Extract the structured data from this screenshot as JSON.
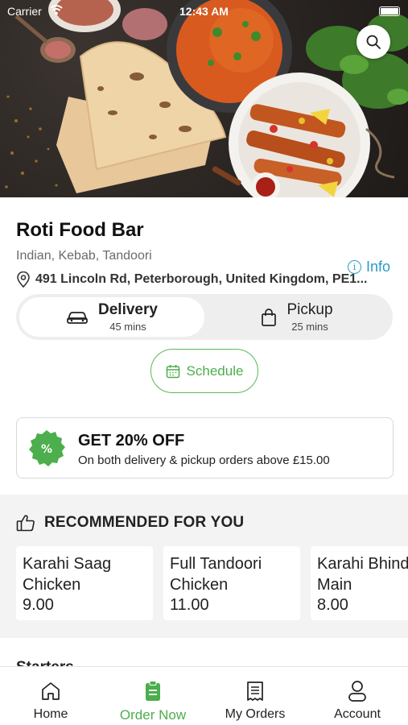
{
  "status_bar": {
    "carrier": "Carrier",
    "time": "12:43 AM"
  },
  "hero": {
    "image": "food-banner-image"
  },
  "restaurant": {
    "name": "Roti Food Bar",
    "cuisine": "Indian, Kebab, Tandoori",
    "info_label": "Info",
    "address": "491 Lincoln Rd, Peterborough, United Kingdom, PE1..."
  },
  "order_mode": {
    "delivery": {
      "label": "Delivery",
      "time": "45 mins",
      "selected": true
    },
    "pickup": {
      "label": "Pickup",
      "time": "25 mins",
      "selected": false
    }
  },
  "schedule": {
    "label": "Schedule"
  },
  "offer": {
    "badge_symbol": "%",
    "title": "GET 20% OFF",
    "description": "On both delivery & pickup orders above £15.00"
  },
  "recommended": {
    "heading": "RECOMMENDED FOR YOU",
    "items": [
      {
        "name": "Karahi Saag\nChicken",
        "price": "9.00"
      },
      {
        "name": "Full Tandoori\nChicken",
        "price": "11.00"
      },
      {
        "name": "Karahi Bhindi\nMain",
        "price": "8.00"
      }
    ]
  },
  "next_section": {
    "title": "Starters"
  },
  "bottom_nav": {
    "items": [
      {
        "label": "Home",
        "icon": "home-icon"
      },
      {
        "label": "Order Now",
        "icon": "order-icon"
      },
      {
        "label": "My Orders",
        "icon": "receipt-icon"
      },
      {
        "label": "Account",
        "icon": "user-icon"
      }
    ],
    "active": "Order Now"
  },
  "colors": {
    "accent_green": "#4cae4c",
    "info_blue": "#2a9bc8"
  }
}
